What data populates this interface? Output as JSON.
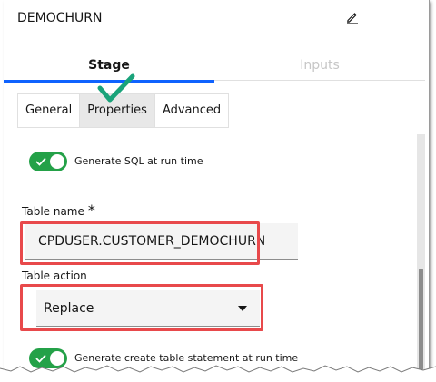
{
  "header": {
    "title": "DEMOCHURN",
    "edit_icon": "pencil-icon"
  },
  "tabs": [
    {
      "label": "Stage",
      "active": true
    },
    {
      "label": "Inputs",
      "active": false
    }
  ],
  "subtabs": [
    {
      "label": "General",
      "active": false
    },
    {
      "label": "Properties",
      "active": true
    },
    {
      "label": "Advanced",
      "active": false
    }
  ],
  "form": {
    "generate_sql": {
      "label": "Generate SQL at run time",
      "on": true
    },
    "table_name": {
      "label": "Table name",
      "required_marker": "*",
      "value": "CPDUSER.CUSTOMER_DEMOCHURN"
    },
    "table_action": {
      "label": "Table action",
      "value": "Replace"
    },
    "generate_create": {
      "label": "Generate create table statement at run time",
      "on": true
    }
  },
  "colors": {
    "accent": "#0f62fe",
    "toggle_on": "#24a148",
    "highlight": "#e8494b",
    "checkmark": "#1aa37a"
  }
}
